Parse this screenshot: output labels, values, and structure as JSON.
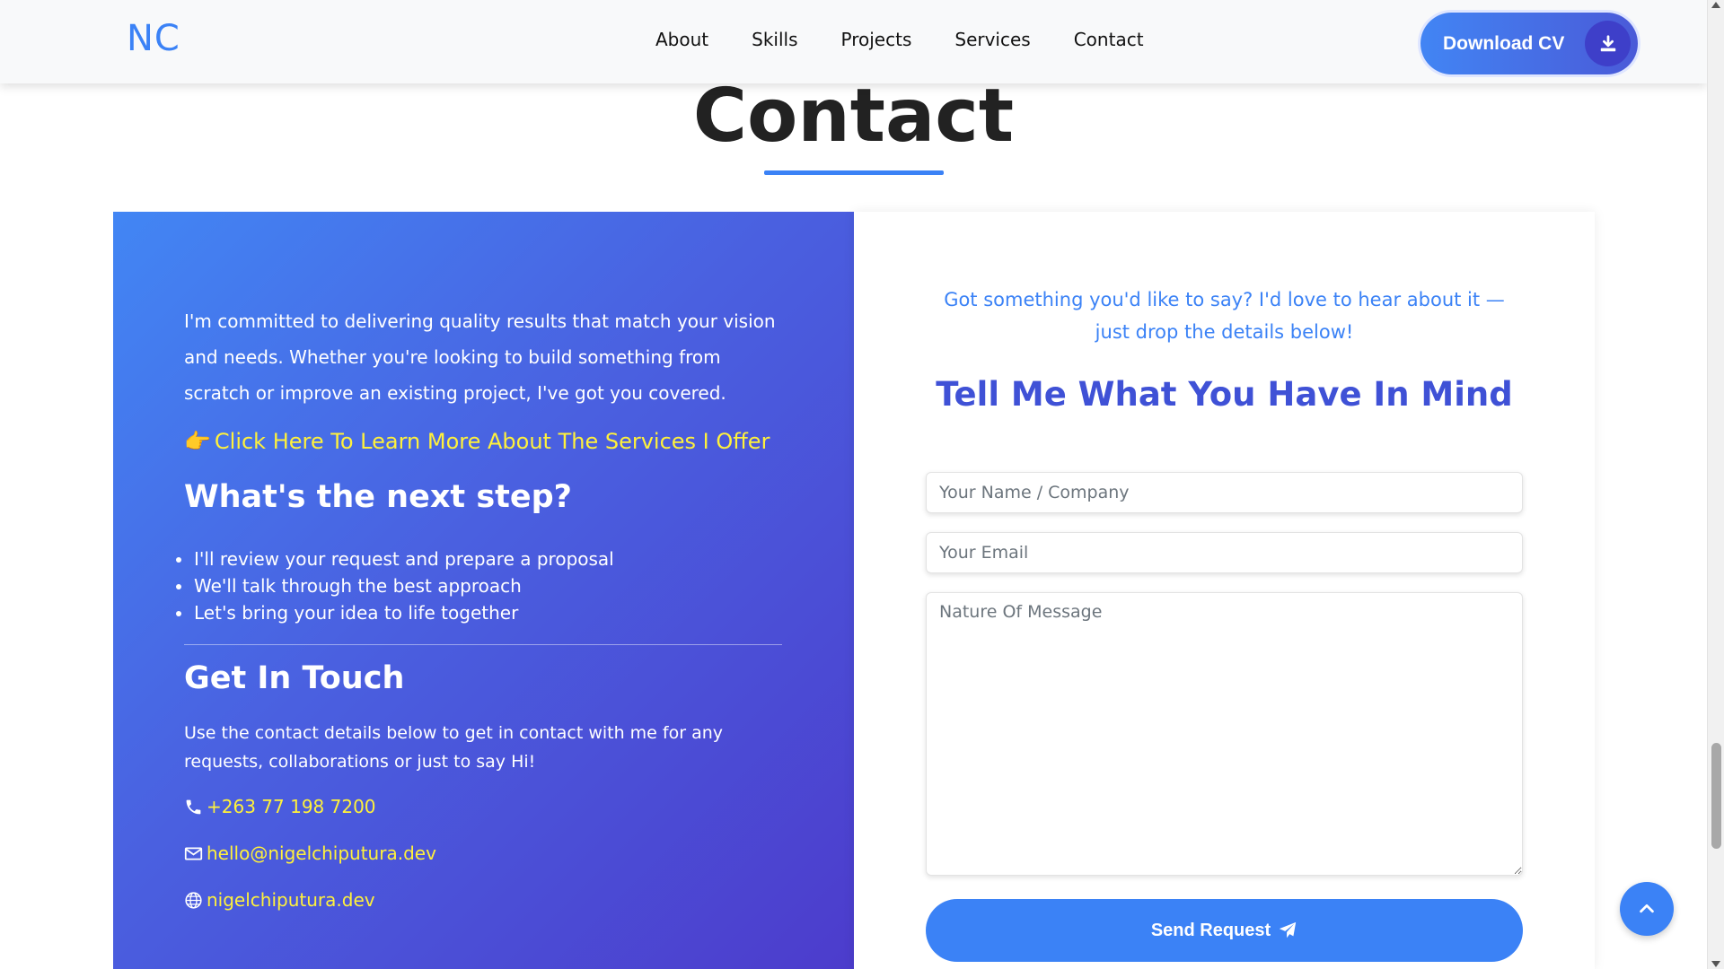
{
  "nav": {
    "logo": "NC",
    "links": [
      "About",
      "Skills",
      "Projects",
      "Services",
      "Contact"
    ],
    "download_label": "Download CV",
    "download_icon": "download-icon"
  },
  "section": {
    "title": "Contact"
  },
  "left": {
    "intro": "I'm committed to delivering quality results that match your vision and needs. Whether you're looking to build something from scratch or improve an existing project, I've got you covered.",
    "services_link_emoji": "👉",
    "services_link": "Click Here To Learn More About The Services I Offer",
    "next_step_title": "What's the next step?",
    "steps": [
      "I'll review your request and prepare a proposal",
      "We'll talk through the best approach",
      "Let's bring your idea to life together"
    ],
    "touch_title": "Get In Touch",
    "touch_desc": "Use the contact details below to get in contact with me for any requests, collaborations or just to say Hi!",
    "phone": "+263 77 198 7200",
    "email": "hello@nigelchiputura.dev",
    "website": "nigelchiputura.dev"
  },
  "form": {
    "intro": "Got something you'd like to say? I'd love to hear about it — just drop the details below!",
    "title": "Tell Me What You Have In Mind",
    "name_placeholder": "Your Name / Company",
    "email_placeholder": "Your Email",
    "message_placeholder": "Nature Of Message",
    "send_label": "Send Request"
  },
  "colors": {
    "accent": "#3b82f6",
    "link_yellow": "#fff13b",
    "title_indigo": "#3f51d6"
  }
}
